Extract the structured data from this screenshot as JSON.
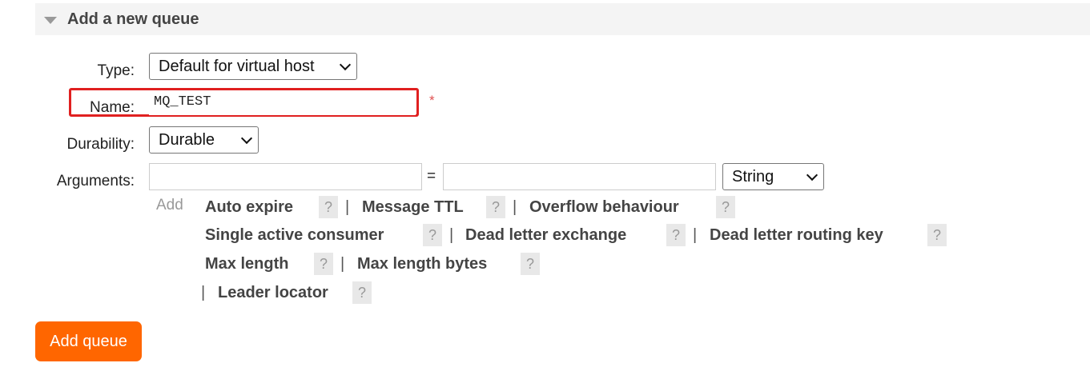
{
  "section": {
    "title": "Add a new queue"
  },
  "form": {
    "type": {
      "label": "Type:",
      "selected": "Default for virtual host"
    },
    "name": {
      "label": "Name:",
      "value": "MQ_TEST",
      "required_marker": "*"
    },
    "durability": {
      "label": "Durability:",
      "selected": "Durable"
    },
    "arguments": {
      "label": "Arguments:",
      "key_value": "",
      "equals": "=",
      "value_value": "",
      "type_selected": "String"
    },
    "add_label": "Add",
    "argument_links": [
      {
        "label": "Auto expire",
        "help": "?"
      },
      {
        "label": "Message TTL",
        "help": "?"
      },
      {
        "label": "Overflow behaviour",
        "help": "?"
      },
      {
        "label": "Single active consumer",
        "help": "?"
      },
      {
        "label": "Dead letter exchange",
        "help": "?"
      },
      {
        "label": "Dead letter routing key",
        "help": "?"
      },
      {
        "label": "Max length",
        "help": "?"
      },
      {
        "label": "Max length bytes",
        "help": "?"
      },
      {
        "label": "Leader locator",
        "help": "?"
      }
    ],
    "separator": "|"
  },
  "actions": {
    "add_queue": "Add queue"
  },
  "colors": {
    "primary_button": "#ff6600",
    "highlight_border": "#e02020",
    "required": "#e05050"
  }
}
